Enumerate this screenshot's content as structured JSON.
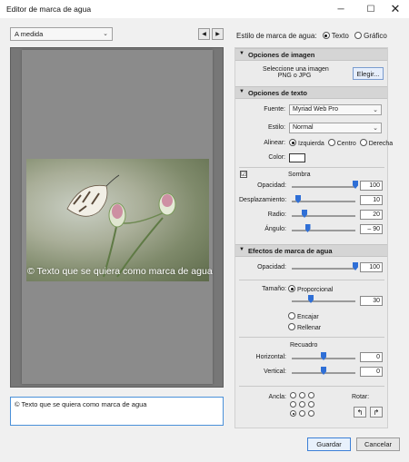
{
  "window": {
    "title": "Editor de marca de agua",
    "controls": {
      "minimize": "─",
      "maximize": "☐",
      "close": "✕"
    }
  },
  "preset": {
    "value": "A medida"
  },
  "nav": {
    "prev": "◀",
    "next": "▶"
  },
  "preview": {
    "watermark_text": "© Texto que se quiera como marca de agua"
  },
  "text_input": {
    "value": "© Texto que se quiera como marca de agua"
  },
  "watermark_style": {
    "label": "Estilo de marca de agua:",
    "options": [
      "Texto",
      "Gráfico"
    ],
    "selected": "Texto"
  },
  "image_options": {
    "header": "Opciones de imagen",
    "hint_line1": "Seleccione una imagen",
    "hint_line2": "PNG o JPG",
    "choose_button": "Elegir..."
  },
  "text_options": {
    "header": "Opciones de texto",
    "font_label": "Fuente:",
    "font_value": "Myriad Web Pro",
    "style_label": "Estilo:",
    "style_value": "Normal",
    "align_label": "Alinear:",
    "align_options": [
      "Izquierda",
      "Centro",
      "Derecha"
    ],
    "align_selected": "Izquierda",
    "color_label": "Color:",
    "color_value": "#ffffff"
  },
  "shadow": {
    "enabled_mark": "☑",
    "label": "Sombra",
    "opacity_label": "Opacidad:",
    "opacity_value": "100",
    "opacity_level": 1.0,
    "offset_label": "Desplazamiento:",
    "offset_value": "10",
    "offset_level": 0.1,
    "radius_label": "Radio:",
    "radius_value": "20",
    "radius_level": 0.2,
    "angle_label": "Ángulo:",
    "angle_value": "– 90",
    "angle_level": 0.25
  },
  "effects": {
    "header": "Efectos de marca de agua",
    "opacity_label": "Opacidad:",
    "opacity_value": "100",
    "opacity_level": 1.0,
    "size_label": "Tamaño:",
    "size_options": [
      "Proporcional",
      "Encajar",
      "Rellenar"
    ],
    "size_selected": "Proporcional",
    "size_value": "30",
    "size_level": 0.3,
    "inset_label": "Recuadro",
    "horizontal_label": "Horizontal:",
    "horizontal_value": "0",
    "horizontal_level": 0.5,
    "vertical_label": "Vertical:",
    "vertical_value": "0",
    "vertical_level": 0.5,
    "anchor_label": "Ancla:",
    "anchor_selected": "bottom-left",
    "rotate_label": "Rotar:",
    "rotate_left": "↰",
    "rotate_right": "↱"
  },
  "footer": {
    "save": "Guardar",
    "cancel": "Cancelar"
  },
  "colors": {
    "accent": "#2f6fd6",
    "section_bg": "#d5d5d5",
    "preview_bg": "#777777"
  }
}
